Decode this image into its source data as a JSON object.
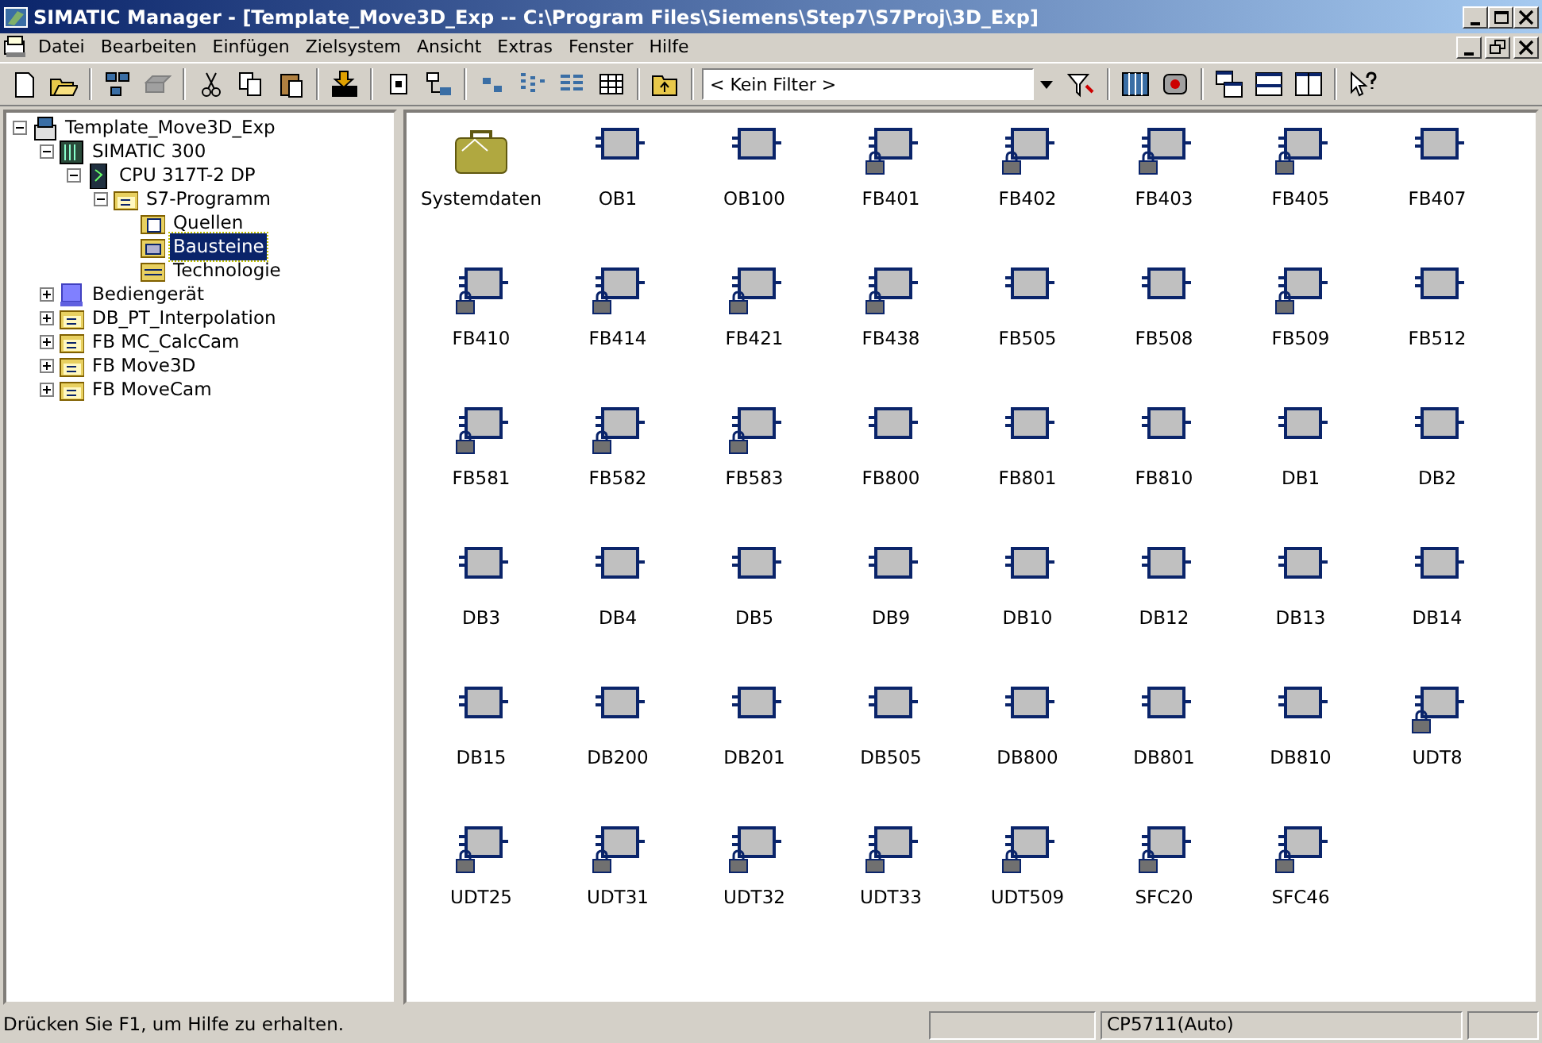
{
  "window": {
    "title": "SIMATIC Manager - [Template_Move3D_Exp -- C:\\Program Files\\Siemens\\Step7\\S7Proj\\3D_Exp]"
  },
  "menu": [
    "Datei",
    "Bearbeiten",
    "Einfügen",
    "Zielsystem",
    "Ansicht",
    "Extras",
    "Fenster",
    "Hilfe"
  ],
  "filter": {
    "value": "< Kein Filter >"
  },
  "tree": [
    {
      "label": "Template_Move3D_Exp",
      "kind": "project",
      "expanded": true,
      "selected": false,
      "children": [
        {
          "label": "SIMATIC 300",
          "kind": "station",
          "expanded": true,
          "selected": false,
          "children": [
            {
              "label": "CPU 317T-2 DP",
              "kind": "cpu",
              "expanded": true,
              "selected": false,
              "children": [
                {
                  "label": "S7-Programm",
                  "kind": "program",
                  "expanded": true,
                  "selected": false,
                  "children": [
                    {
                      "label": "Quellen",
                      "kind": "sources",
                      "selected": false
                    },
                    {
                      "label": "Bausteine",
                      "kind": "blocks",
                      "selected": true
                    },
                    {
                      "label": "Technologie",
                      "kind": "tech",
                      "selected": false
                    }
                  ]
                }
              ]
            }
          ]
        },
        {
          "label": "Bediengerät",
          "kind": "hmi",
          "expanded": false,
          "selected": false
        },
        {
          "label": "DB_PT_Interpolation",
          "kind": "program",
          "expanded": false,
          "selected": false
        },
        {
          "label": "FB MC_CalcCam",
          "kind": "program",
          "expanded": false,
          "selected": false
        },
        {
          "label": "FB Move3D",
          "kind": "program",
          "expanded": false,
          "selected": false
        },
        {
          "label": "FB MoveCam",
          "kind": "program",
          "expanded": false,
          "selected": false
        }
      ]
    }
  ],
  "blocks": [
    {
      "label": "Systemdaten",
      "kind": "system"
    },
    {
      "label": "OB1",
      "kind": "block",
      "locked": false
    },
    {
      "label": "OB100",
      "kind": "block",
      "locked": false
    },
    {
      "label": "FB401",
      "kind": "block",
      "locked": true
    },
    {
      "label": "FB402",
      "kind": "block",
      "locked": true
    },
    {
      "label": "FB403",
      "kind": "block",
      "locked": true
    },
    {
      "label": "FB405",
      "kind": "block",
      "locked": true
    },
    {
      "label": "FB407",
      "kind": "block",
      "locked": false
    },
    {
      "label": "FB410",
      "kind": "block",
      "locked": true
    },
    {
      "label": "FB414",
      "kind": "block",
      "locked": true
    },
    {
      "label": "FB421",
      "kind": "block",
      "locked": true
    },
    {
      "label": "FB438",
      "kind": "block",
      "locked": true
    },
    {
      "label": "FB505",
      "kind": "block",
      "locked": false
    },
    {
      "label": "FB508",
      "kind": "block",
      "locked": false
    },
    {
      "label": "FB509",
      "kind": "block",
      "locked": true
    },
    {
      "label": "FB512",
      "kind": "block",
      "locked": false
    },
    {
      "label": "FB581",
      "kind": "block",
      "locked": true
    },
    {
      "label": "FB582",
      "kind": "block",
      "locked": true
    },
    {
      "label": "FB583",
      "kind": "block",
      "locked": true
    },
    {
      "label": "FB800",
      "kind": "block",
      "locked": false
    },
    {
      "label": "FB801",
      "kind": "block",
      "locked": false
    },
    {
      "label": "FB810",
      "kind": "block",
      "locked": false
    },
    {
      "label": "DB1",
      "kind": "block",
      "locked": false
    },
    {
      "label": "DB2",
      "kind": "block",
      "locked": false
    },
    {
      "label": "DB3",
      "kind": "block",
      "locked": false
    },
    {
      "label": "DB4",
      "kind": "block",
      "locked": false
    },
    {
      "label": "DB5",
      "kind": "block",
      "locked": false
    },
    {
      "label": "DB9",
      "kind": "block",
      "locked": false
    },
    {
      "label": "DB10",
      "kind": "block",
      "locked": false
    },
    {
      "label": "DB12",
      "kind": "block",
      "locked": false
    },
    {
      "label": "DB13",
      "kind": "block",
      "locked": false
    },
    {
      "label": "DB14",
      "kind": "block",
      "locked": false
    },
    {
      "label": "DB15",
      "kind": "block",
      "locked": false
    },
    {
      "label": "DB200",
      "kind": "block",
      "locked": false
    },
    {
      "label": "DB201",
      "kind": "block",
      "locked": false
    },
    {
      "label": "DB505",
      "kind": "block",
      "locked": false
    },
    {
      "label": "DB800",
      "kind": "block",
      "locked": false
    },
    {
      "label": "DB801",
      "kind": "block",
      "locked": false
    },
    {
      "label": "DB810",
      "kind": "block",
      "locked": false
    },
    {
      "label": "UDT8",
      "kind": "block",
      "locked": true
    },
    {
      "label": "UDT25",
      "kind": "block",
      "locked": true
    },
    {
      "label": "UDT31",
      "kind": "block",
      "locked": true
    },
    {
      "label": "UDT32",
      "kind": "block",
      "locked": true
    },
    {
      "label": "UDT33",
      "kind": "block",
      "locked": true
    },
    {
      "label": "UDT509",
      "kind": "block",
      "locked": true
    },
    {
      "label": "SFC20",
      "kind": "block",
      "locked": true
    },
    {
      "label": "SFC46",
      "kind": "block",
      "locked": true
    }
  ],
  "status_bar": {
    "message": "Drücken Sie F1, um Hilfe zu erhalten.",
    "interface": "CP5711(Auto)"
  }
}
